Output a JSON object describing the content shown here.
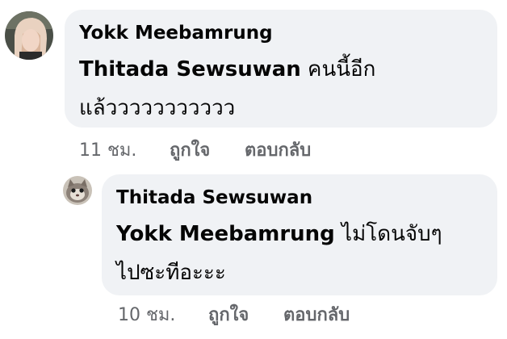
{
  "comments": [
    {
      "author": "Yokk Meebamrung",
      "mention": "Thitada Sewsuwan",
      "text_line1": " คนนี้อีก",
      "text_line2": "แล้ววววววววววว",
      "time": "11 ชม.",
      "like_label": "ถูกใจ",
      "reply_label": "ตอบกลับ"
    },
    {
      "author": "Thitada Sewsuwan",
      "mention": "Yokk Meebamrung",
      "text_line1": " ไม่โดนจับๆ",
      "text_line2": "ไปซะทีอะะะ",
      "time": "10 ชม.",
      "like_label": "ถูกใจ",
      "reply_label": "ตอบกลับ"
    }
  ]
}
